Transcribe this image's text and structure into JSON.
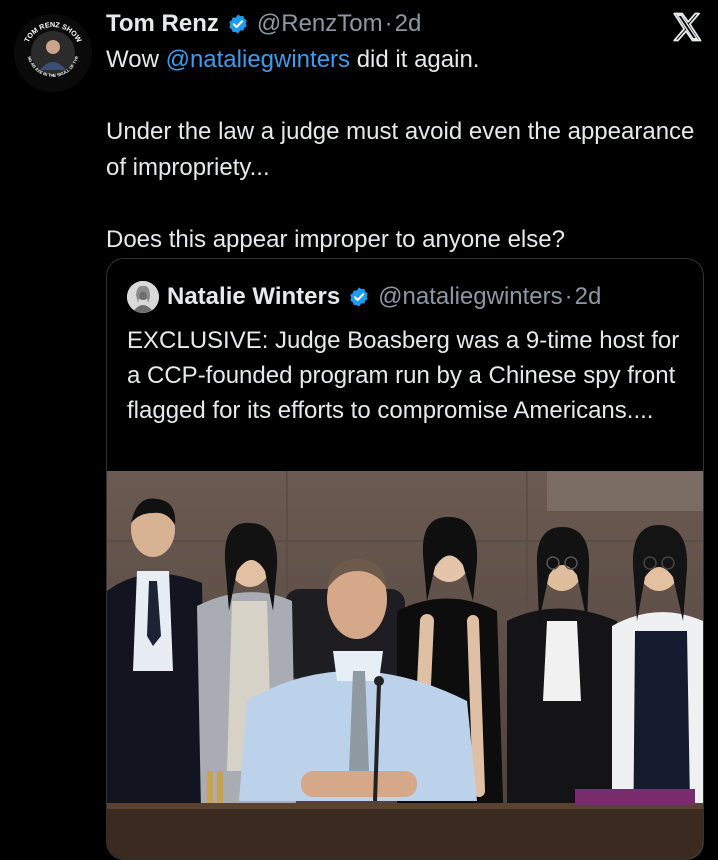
{
  "tweet": {
    "author_name": "Tom Renz",
    "handle": "@RenzTom",
    "separator": "·",
    "time": "2d",
    "text_before_mention": "Wow ",
    "mention": "@nataliegwinters",
    "text_after_mention": " did it again.",
    "paragraph2": "Under the law a judge must avoid even the appearance of impropriety...",
    "paragraph3": "Does this appear improper to anyone else?",
    "avatar_badge_top": "TOM RENZ SHOW",
    "avatar_badge_bottom": "PUTTING AN AXE IN THE SKULL OF TYRANNY"
  },
  "quote": {
    "author_name": "Natalie Winters",
    "handle": "@nataliegwinters",
    "separator": "·",
    "time": "2d",
    "text": "EXCLUSIVE: Judge Boasberg was a 9-time host for a CCP-founded program run by a Chinese spy front flagged for its efforts to compromise Americans...."
  },
  "icons": {
    "verified": "verified-badge-icon",
    "platform": "x-logo-icon"
  },
  "colors": {
    "background": "#000000",
    "text": "#e7e9ea",
    "muted": "#8b98a5",
    "link": "#3b9df0",
    "verified": "#1d9bf0",
    "border": "#2f3336"
  }
}
